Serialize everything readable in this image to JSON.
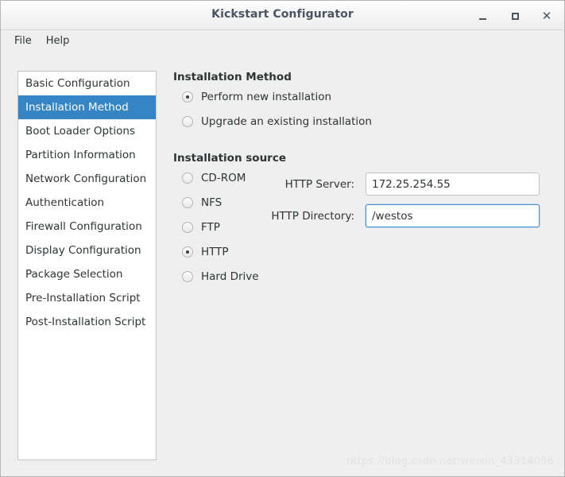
{
  "window": {
    "title": "Kickstart Configurator",
    "controls": {
      "minimize": "–",
      "maximize": "□",
      "close": "✕"
    }
  },
  "menubar": {
    "items": [
      {
        "label": "File"
      },
      {
        "label": "Help"
      }
    ]
  },
  "sidebar": {
    "items": [
      {
        "label": "Basic Configuration",
        "selected": false
      },
      {
        "label": "Installation Method",
        "selected": true
      },
      {
        "label": "Boot Loader Options",
        "selected": false
      },
      {
        "label": "Partition Information",
        "selected": false
      },
      {
        "label": "Network Configuration",
        "selected": false
      },
      {
        "label": "Authentication",
        "selected": false
      },
      {
        "label": "Firewall Configuration",
        "selected": false
      },
      {
        "label": "Display Configuration",
        "selected": false
      },
      {
        "label": "Package Selection",
        "selected": false
      },
      {
        "label": "Pre-Installation Script",
        "selected": false
      },
      {
        "label": "Post-Installation Script",
        "selected": false
      }
    ]
  },
  "panel": {
    "method_section": {
      "title": "Installation Method",
      "options": [
        {
          "label": "Perform new installation",
          "selected": true
        },
        {
          "label": "Upgrade an existing installation",
          "selected": false
        }
      ]
    },
    "source_section": {
      "title": "Installation source",
      "options": [
        {
          "label": "CD-ROM",
          "selected": false
        },
        {
          "label": "NFS",
          "selected": false
        },
        {
          "label": "FTP",
          "selected": false
        },
        {
          "label": "HTTP",
          "selected": true
        },
        {
          "label": "Hard Drive",
          "selected": false
        }
      ],
      "fields": [
        {
          "label": "HTTP Server:",
          "value": "172.25.254.55",
          "focused": false
        },
        {
          "label": "HTTP Directory:",
          "value": "/westos",
          "focused": true
        }
      ]
    }
  },
  "watermark": {
    "text": "https://blog.csdn.net/weixin_43314056"
  },
  "colors": {
    "selection_blue": "#3584c4",
    "focus_blue": "#4a90d9",
    "window_bg": "#efefef",
    "text": "#2e3436",
    "title_text": "#4b5561"
  }
}
